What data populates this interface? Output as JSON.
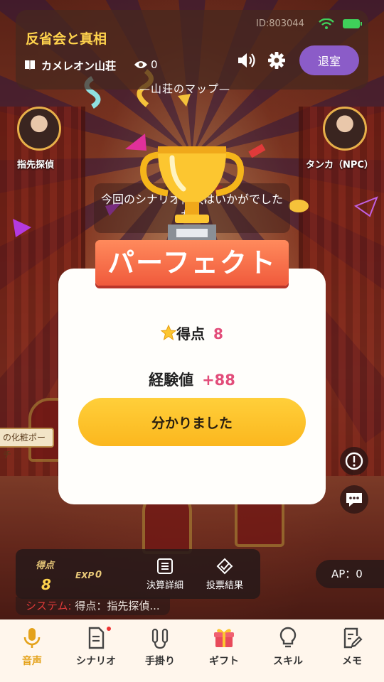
{
  "header": {
    "room_title": "反省会と真相",
    "room_id": "ID:803044",
    "scenario_name": "カメレオン山荘",
    "viewer_count": "0",
    "leave_label": "退室",
    "map_label": "山荘のマップ",
    "icons": {
      "book": "book-icon",
      "eye": "eye-icon",
      "speaker": "speaker-icon",
      "settings": "gear-icon",
      "wifi": "wifi-icon",
      "battery": "battery-icon"
    }
  },
  "characters": {
    "left_label": "指先探偵",
    "right_label": "タンカ（NPC）"
  },
  "background_prompt": "今回のシナリオ体験はいかがでしたか？",
  "result_modal": {
    "banner": "パーフェクト",
    "score_label": "得点",
    "score_value": "8",
    "exp_label": "経験値",
    "exp_value": "+88",
    "confirm_label": "分かりました",
    "accent_color": "#e24d7a",
    "button_color": "#fbb71e"
  },
  "side": {
    "item_tag": "の化粧ポーチ",
    "alert_icon": "exclamation-icon",
    "chat_icon": "chat-icon"
  },
  "bottom_panel": {
    "score_label": "得点",
    "score_value": "8",
    "exp_label": "EXP",
    "exp_value": "0",
    "settlement_label": "決算詳細",
    "vote_label": "投票結果"
  },
  "ap_badge": "AP：0",
  "system_message": {
    "prefix": "システム:",
    "text": "得点：指先探偵..."
  },
  "nav": {
    "items": [
      {
        "label": "音声",
        "icon": "microphone-icon",
        "active": true
      },
      {
        "label": "シナリオ",
        "icon": "document-icon",
        "active": false,
        "badge": true
      },
      {
        "label": "手掛り",
        "icon": "clue-icon",
        "active": false
      },
      {
        "label": "ギフト",
        "icon": "gift-icon",
        "active": false
      },
      {
        "label": "スキル",
        "icon": "lightbulb-icon",
        "active": false
      },
      {
        "label": "メモ",
        "icon": "memo-icon",
        "active": false
      }
    ]
  }
}
